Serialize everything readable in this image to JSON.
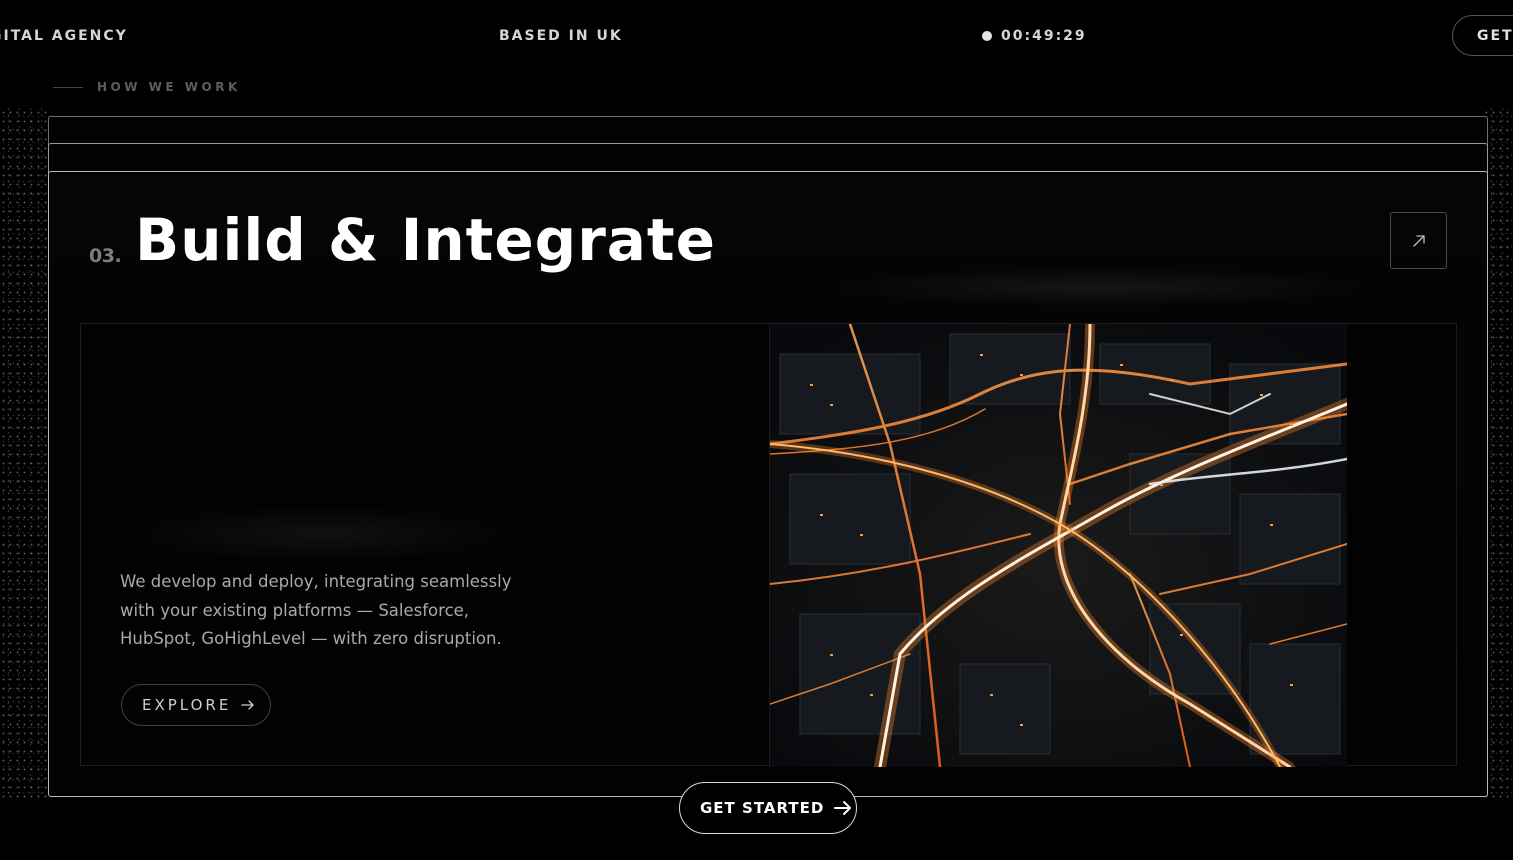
{
  "nav": {
    "agency": "GITAL AGENCY",
    "location": "BASED IN UK",
    "clock": "00:49:29",
    "cta_label": "GET"
  },
  "section": {
    "label": "HOW WE WORK"
  },
  "card": {
    "number": "03.",
    "title": "Build & Integrate",
    "description": "We develop and deploy, integrating seamlessly with your existing platforms — Salesforce, HubSpot, GoHighLevel — with zero disruption.",
    "explore_label": "EXPLORE",
    "image": "circuit-city-illustration"
  },
  "cta": {
    "label": "GET STARTED"
  },
  "colors": {
    "background": "#000000",
    "accent": "#ff8a2b",
    "text": "#ffffff",
    "muted": "#a9a9a9"
  },
  "icons": {
    "arrow_up_right": "arrow-up-right-icon",
    "arrow_right": "arrow-right-icon"
  }
}
